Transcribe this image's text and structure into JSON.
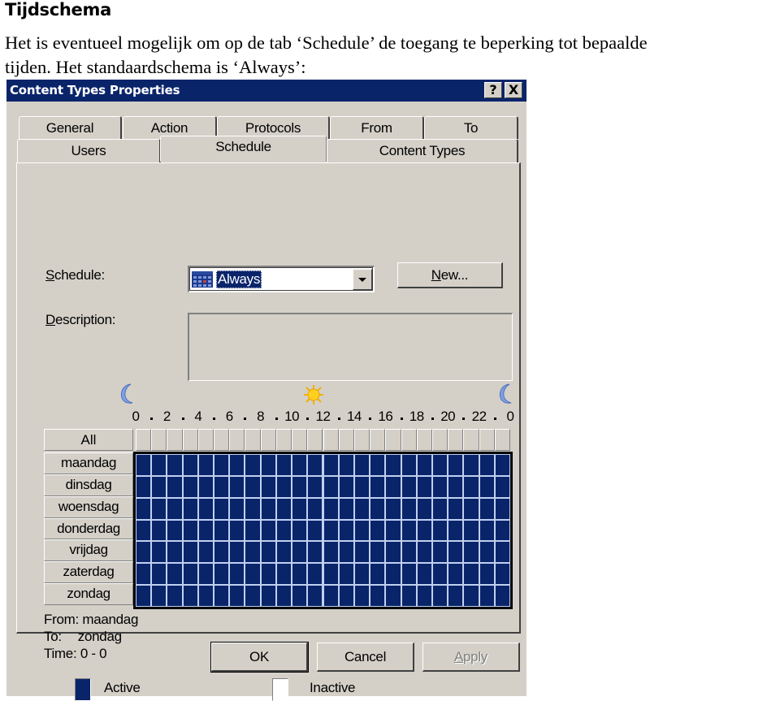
{
  "document": {
    "heading": "Tijdschema",
    "paragraph_line1": "Het is eventueel mogelijk om op de tab ‘Schedule’ de toegang te beperking tot bepaalde",
    "paragraph_line2": "tijden. Het standaardschema is ‘Always’:"
  },
  "dialog": {
    "title": "Content Types Properties",
    "help_button": "?",
    "close_button": "X",
    "tabs_row1": [
      {
        "label": "General"
      },
      {
        "label": "Action"
      },
      {
        "label": "Protocols"
      },
      {
        "label": "From"
      },
      {
        "label": "To"
      }
    ],
    "tabs_row2": [
      {
        "label": "Users"
      },
      {
        "label": "Schedule",
        "selected": true
      },
      {
        "label": "Content Types"
      }
    ],
    "schedule": {
      "label_accel": "S",
      "label_rest": "chedule:",
      "value": "Always",
      "new_button_accel": "N",
      "new_button_rest": "ew..."
    },
    "description": {
      "label_accel": "D",
      "label_rest": "escription:",
      "value": ""
    },
    "hour_labels": [
      "0",
      "2",
      "4",
      "6",
      "8",
      "10",
      "12",
      "14",
      "16",
      "18",
      "20",
      "22",
      "0"
    ],
    "grid": {
      "all_label": "All",
      "days": [
        "maandag",
        "dinsdag",
        "woensdag",
        "donderdag",
        "vrijdag",
        "zaterdag",
        "zondag"
      ],
      "hours_per_day": 24,
      "active_all": true
    },
    "info": {
      "from_label": "From:",
      "from_value": "maandag",
      "to_label": "To:",
      "to_value": "zondag",
      "time_label": "Time:",
      "time_value": "0 - 0"
    },
    "legend": {
      "active_label": "Active",
      "inactive_label": "Inactive",
      "active_color": "#0a246a",
      "inactive_color": "#ffffff"
    },
    "buttons": {
      "ok": "OK",
      "cancel": "Cancel",
      "apply_accel": "A",
      "apply_rest": "pply"
    }
  },
  "colors": {
    "titlebar": "#0a246a",
    "dialog_face": "#d4d0c8",
    "grid_active": "#0a246a"
  }
}
